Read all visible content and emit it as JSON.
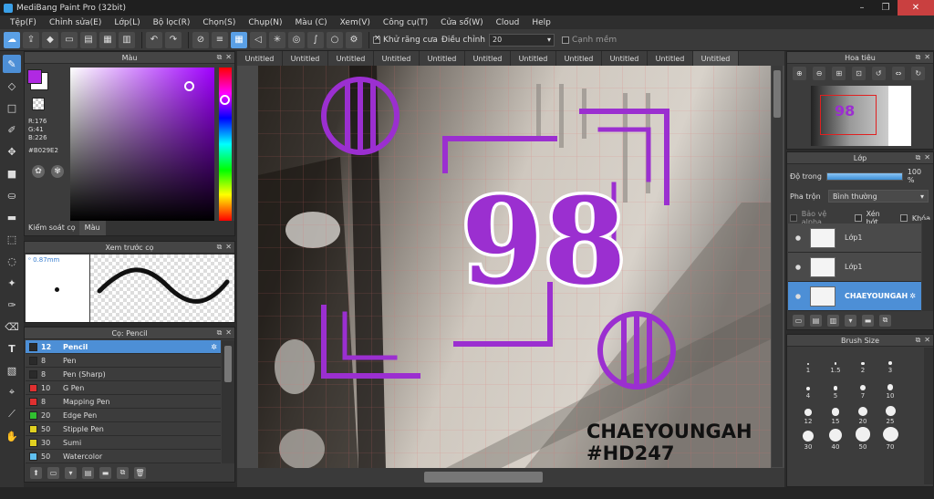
{
  "app": {
    "title": "MediBang Paint Pro (32bit)"
  },
  "window_buttons": {
    "minimize": "–",
    "restore": "❐",
    "close": "✕"
  },
  "menu": [
    "Tệp(F)",
    "Chỉnh sửa(E)",
    "Lớp(L)",
    "Bộ lọc(R)",
    "Chọn(S)",
    "Chụp(N)",
    "Màu (C)",
    "Xem(V)",
    "Công cụ(T)",
    "Cửa sổ(W)",
    "Cloud",
    "Help"
  ],
  "toolbar": {
    "antialias_label": "Khử răng cưa",
    "adjust_label": "Điều chỉnh",
    "adjust_value": "20",
    "snap_label": "Cạnh mềm"
  },
  "color_panel": {
    "title": "Màu",
    "r": "R:176",
    "g": "G:41",
    "b": "B:226",
    "hex": "#B029E2",
    "tab_brush_control": "Kiểm soát cọ",
    "tab_color": "Màu",
    "colors": {
      "primary": "#B029E2",
      "hue": "#a000ff"
    }
  },
  "preview_panel": {
    "title": "Xem trước cọ",
    "size": "0.87mm"
  },
  "brush_panel": {
    "title": "Cọ: Pencil",
    "brushes": [
      {
        "size": "12",
        "name": "Pencil",
        "color": "#2a2a2a",
        "selected": true
      },
      {
        "size": "8",
        "name": "Pen",
        "color": "#2a2a2a",
        "selected": false
      },
      {
        "size": "8",
        "name": "Pen (Sharp)",
        "color": "#2a2a2a",
        "selected": false
      },
      {
        "size": "10",
        "name": "G Pen",
        "color": "#e03030",
        "selected": false
      },
      {
        "size": "8",
        "name": "Mapping Pen",
        "color": "#e03030",
        "selected": false
      },
      {
        "size": "20",
        "name": "Edge Pen",
        "color": "#30c030",
        "selected": false
      },
      {
        "size": "50",
        "name": "Stipple Pen",
        "color": "#e0d020",
        "selected": false
      },
      {
        "size": "30",
        "name": "Sumi",
        "color": "#e0d020",
        "selected": false
      },
      {
        "size": "50",
        "name": "Watercolor",
        "color": "#60c0f0",
        "selected": false
      }
    ]
  },
  "tabs": [
    "Untitled",
    "Untitled",
    "Untitled",
    "Untitled",
    "Untitled",
    "Untitled",
    "Untitled",
    "Untitled",
    "Untitled",
    "Untitled",
    "Untitled"
  ],
  "artwork": {
    "number": "98",
    "caption_line1": "CHAEYOUNGAH",
    "caption_line2": "#HD247",
    "purple": "#9b2fd0"
  },
  "navigator": {
    "title": "Hoa tiêu"
  },
  "layer_panel": {
    "title": "Lớp",
    "opacity_label": "Độ trong",
    "opacity_value": "100 %",
    "opacity_fraction": 1.0,
    "blend_label": "Pha trộn",
    "blend_value": "Bình thường",
    "protect_alpha": "Bảo vệ alpha",
    "clipping": "Xén bớt",
    "lock": "Khóa",
    "layers": [
      {
        "name": "Lớp1",
        "selected": false
      },
      {
        "name": "Lớp1",
        "selected": false
      },
      {
        "name": "CHAEYOUNGAH",
        "selected": true
      }
    ]
  },
  "brush_size_panel": {
    "title": "Brush Size",
    "sizes": [
      "1",
      "1.5",
      "2",
      "3",
      "4",
      "5",
      "7",
      "10",
      "12",
      "15",
      "20",
      "25",
      "30",
      "40",
      "50",
      "70"
    ]
  }
}
